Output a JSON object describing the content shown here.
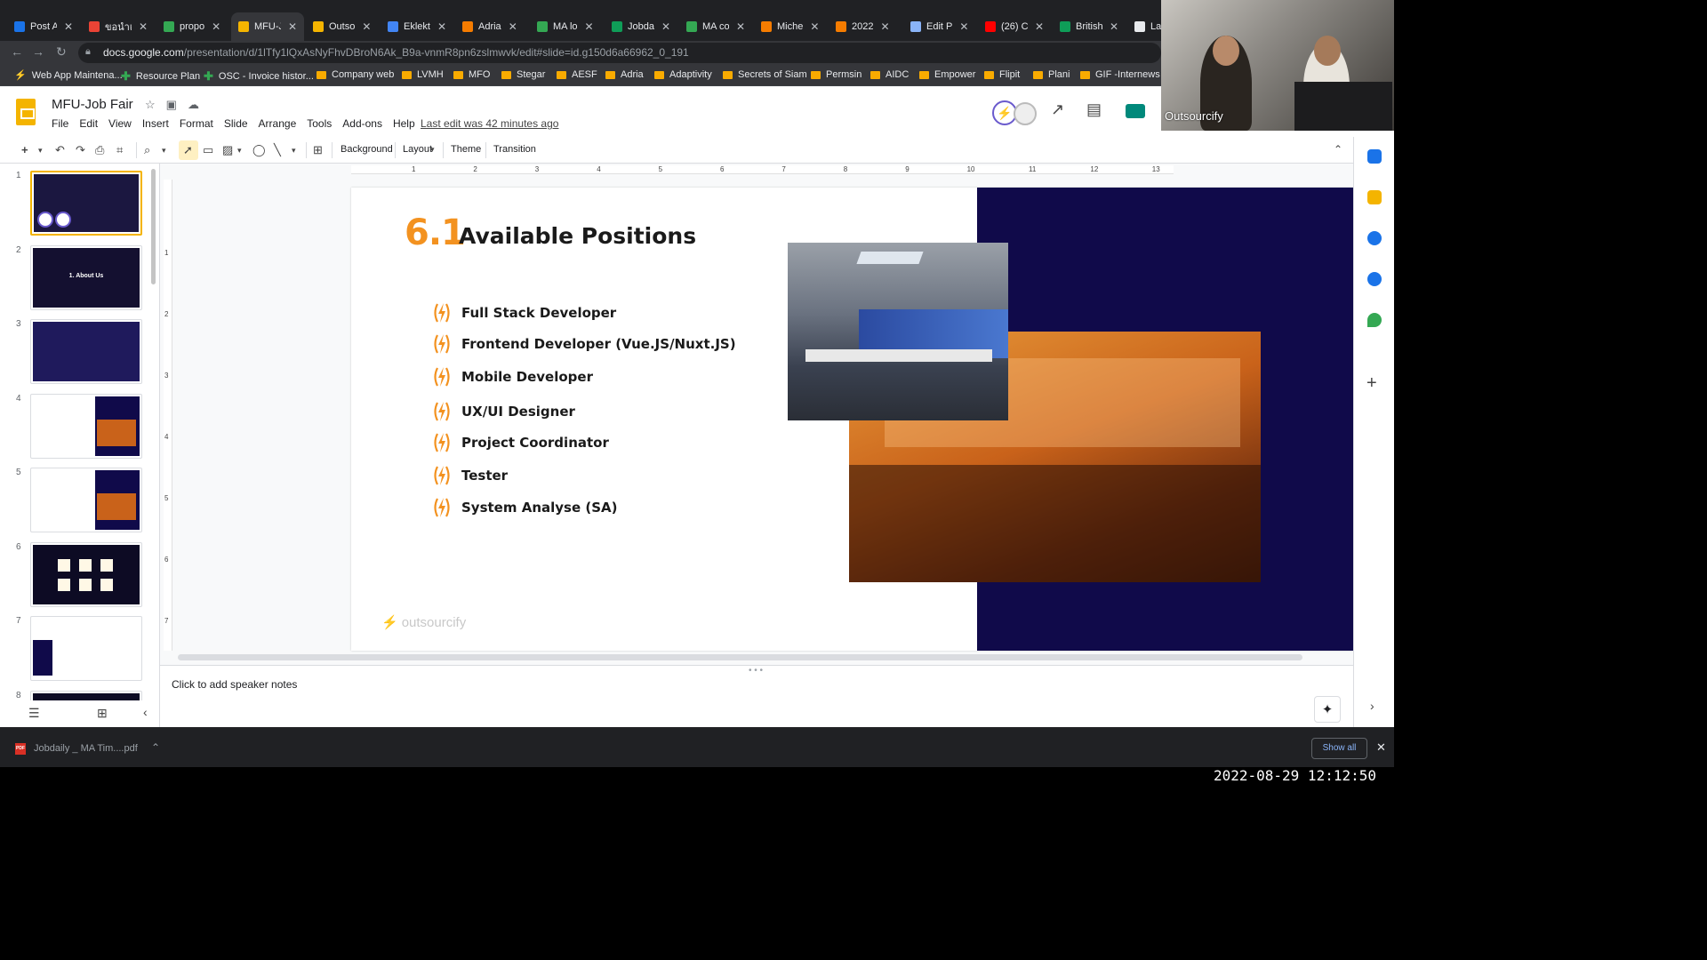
{
  "browser": {
    "tabs": [
      {
        "label": "Post A",
        "color": "#1a73e8"
      },
      {
        "label": "ขอนำเ",
        "color": "#ea4335"
      },
      {
        "label": "propo",
        "color": "#34a853"
      },
      {
        "label": "MFU-J",
        "color": "#f4b400",
        "active": true
      },
      {
        "label": "Outso",
        "color": "#f4b400"
      },
      {
        "label": "Eklekt",
        "color": "#4285f4"
      },
      {
        "label": "Adria",
        "color": "#f57c00"
      },
      {
        "label": "MA lo",
        "color": "#34a853"
      },
      {
        "label": "Jobda",
        "color": "#0f9d58"
      },
      {
        "label": "MA co",
        "color": "#34a853"
      },
      {
        "label": "Miche",
        "color": "#f57c00"
      },
      {
        "label": "2022",
        "color": "#f57c00"
      },
      {
        "label": "Edit P",
        "color": "#8ab4f8"
      },
      {
        "label": "(26) C",
        "color": "#ff0000"
      },
      {
        "label": "British",
        "color": "#0f9d58"
      },
      {
        "label": "Lau",
        "color": "#e8eaed"
      }
    ],
    "url_host": "docs.google.com",
    "url_path": "/presentation/d/1lTfy1lQxAsNyFhvDBroN6Ak_B9a-vnmR8pn6zslmwvk/edit#slide=id.g150d6a66962_0_191",
    "bookmarks": [
      {
        "label": "Web App Maintena...",
        "kind": "bolt"
      },
      {
        "label": "Resource Plan",
        "kind": "cross"
      },
      {
        "label": "OSC - Invoice histor...",
        "kind": "cross"
      },
      {
        "label": "Company web",
        "kind": "folder"
      },
      {
        "label": "LVMH",
        "kind": "folder"
      },
      {
        "label": "MFO",
        "kind": "folder"
      },
      {
        "label": "Stegar",
        "kind": "folder"
      },
      {
        "label": "AESF",
        "kind": "folder"
      },
      {
        "label": "Adria",
        "kind": "folder"
      },
      {
        "label": "Adaptivity",
        "kind": "folder"
      },
      {
        "label": "Secrets of Siam",
        "kind": "folder"
      },
      {
        "label": "Permsin",
        "kind": "folder"
      },
      {
        "label": "AIDC",
        "kind": "folder"
      },
      {
        "label": "Empower",
        "kind": "folder"
      },
      {
        "label": "Flipit",
        "kind": "folder"
      },
      {
        "label": "Plani",
        "kind": "folder"
      },
      {
        "label": "GIF -Internews",
        "kind": "folder"
      }
    ]
  },
  "app": {
    "title": "MFU-Job Fair",
    "menus": [
      "File",
      "Edit",
      "View",
      "Insert",
      "Format",
      "Slide",
      "Arrange",
      "Tools",
      "Add-ons",
      "Help"
    ],
    "last_edit": "Last edit was 42 minutes ago",
    "video_label": "Outsourcify"
  },
  "toolbar": {
    "background": "Background",
    "layout": "Layout",
    "theme": "Theme",
    "transition": "Transition"
  },
  "ruler": {
    "h_ticks": [
      "1",
      "2",
      "3",
      "4",
      "5",
      "6",
      "7",
      "8",
      "9",
      "10",
      "11",
      "12",
      "13"
    ],
    "v_ticks": [
      "1",
      "2",
      "3",
      "4",
      "5",
      "6",
      "7"
    ]
  },
  "filmstrip": {
    "numbers": [
      "1",
      "2",
      "3",
      "4",
      "5",
      "6",
      "7",
      "8"
    ],
    "slide2_title": "1. About Us"
  },
  "slide": {
    "number": "6.1",
    "title": "Available Positions",
    "positions": [
      "Full Stack Developer",
      "Frontend Developer (Vue.JS/Nuxt.JS)",
      "Mobile Developer",
      "UX/UI Designer",
      "Project Coordinator",
      "Tester",
      "System Analyse (SA)"
    ],
    "logo_text": "outsourcify",
    "accent": "#f39220",
    "dark_panel": "#100a4a"
  },
  "notes": {
    "placeholder": "Click to add speaker notes"
  },
  "downloads": {
    "file_name": "Jobdaily _ MA Tim....pdf",
    "file_icon_text": "PDF",
    "show_all": "Show all"
  },
  "timestamp": "2022-08-29 12:12:50"
}
